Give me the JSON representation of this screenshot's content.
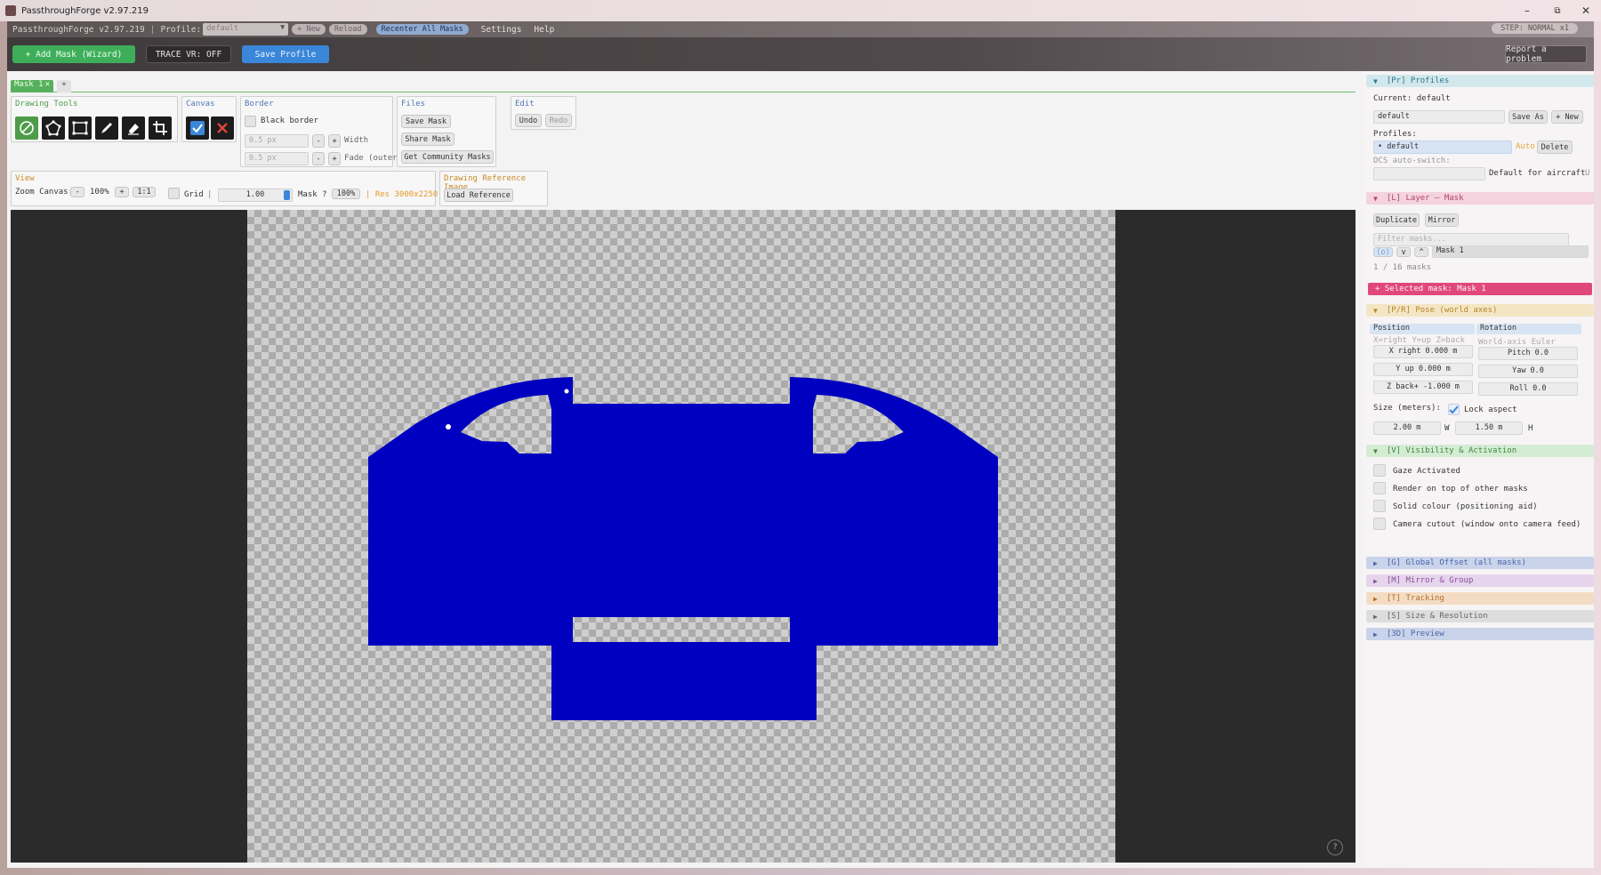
{
  "window": {
    "title": "PassthroughForge v2.97.219",
    "minimize": "–",
    "maximize": "⧉",
    "close": "✕"
  },
  "menubar": {
    "app_version": "PassthroughForge v2.97.219",
    "profile_label": "Profile:",
    "profile_value": "default",
    "new_label": "+ New",
    "reload_label": "Reload",
    "recenter_label": "Recenter All Masks",
    "settings_label": "Settings",
    "help_label": "Help",
    "step_label": "STEP: NORMAL  x1"
  },
  "toolbar": {
    "add_mask_label": "+  Add Mask  (Wizard)",
    "trace_label": "TRACE VR: OFF",
    "save_profile_label": "Save Profile",
    "report_label": "Report a problem"
  },
  "tabs": {
    "mask_tab": "Mask 1",
    "close_glyph": "✕",
    "add_glyph": "+"
  },
  "drawing_tools": {
    "title": "Drawing Tools",
    "tools": [
      "select-tool",
      "polygon-tool",
      "rectangle-tool",
      "pen-tool",
      "eraser-tool",
      "crop-tool"
    ]
  },
  "canvas_group": {
    "title": "Canvas"
  },
  "border": {
    "title": "Border",
    "black_border_label": "Black border",
    "width_value": "0.5 px",
    "width_label": "Width",
    "fade_value": "0.5 px",
    "fade_label": "Fade (outer)",
    "minus": "-",
    "plus": "+"
  },
  "files": {
    "title": "Files",
    "save_mask": "Save Mask",
    "share_mask": "Share Mask",
    "community": "Get Community Masks"
  },
  "edit": {
    "title": "Edit",
    "undo": "Undo",
    "redo": "Redo"
  },
  "view": {
    "title": "View",
    "zoom_label": "Zoom Canvas:",
    "zoom_minus": "-",
    "zoom_value": "100%",
    "zoom_plus": "+",
    "zoom_reset": "1:1",
    "grid_label": "Grid",
    "divider": "|",
    "opacity_value": "1.00",
    "mask_label": "Mask ?",
    "mask_pct": "100%",
    "res_label": "| Res 3000x2250"
  },
  "reference": {
    "title": "Drawing Reference Image",
    "load": "Load Reference"
  },
  "canvas": {
    "help": "?",
    "mask_color": "#0000c0"
  },
  "profiles": {
    "header": "[Pr] Profiles",
    "current_label": "Current: default",
    "name_value": "default",
    "save_as": "Save As",
    "new": "+ New",
    "profiles_label": "Profiles:",
    "list_item": "• default",
    "auto_label": "Auto",
    "delete_label": "Delete",
    "dcs_label": "DCS auto-switch:",
    "default_aircraft": "Default for aircraft",
    "u_label": "U"
  },
  "layer": {
    "header": "[L] Layer – Mask",
    "duplicate": "Duplicate",
    "mirror": "Mirror",
    "filter_placeholder": "Filter masks...",
    "eye_btn": "(o)",
    "down_btn": "v",
    "up_btn": "^",
    "mask_name": "Mask 1",
    "count": "1 / 16 masks"
  },
  "selected": {
    "label": "+  Selected mask:  Mask 1"
  },
  "pose": {
    "header": "[P/R] Pose (world axes)",
    "position_label": "Position",
    "rotation_label": "Rotation",
    "axes_hint": "X=right Y=up Z=back",
    "euler_hint": "World-axis Euler",
    "x_field": "X right  0.000 m",
    "y_field": "Y up   0.000 m",
    "z_field": "Z back+ -1.000 m",
    "pitch_field": "Pitch 0.0",
    "yaw_field": "Yaw  0.0",
    "roll_field": "Roll 0.0",
    "size_label": "Size (meters):",
    "lock_label": "Lock aspect",
    "width_value": "2.00 m",
    "w_label": "W",
    "height_value": "1.50 m",
    "h_label": "H"
  },
  "visibility": {
    "header": "[V] Visibility & Activation",
    "options": [
      "Gaze Activated",
      "Render on top of other masks",
      "Solid colour (positioning aid)",
      "Camera cutout (window onto camera feed)"
    ]
  },
  "collapsed_sections": [
    {
      "label": "[G] Global Offset (all masks)",
      "color": "#c9d3ea",
      "text": "#4a66a8"
    },
    {
      "label": "[M] Mirror & Group",
      "color": "#e6d4ec",
      "text": "#8a4e9a"
    },
    {
      "label": "[T] Tracking",
      "color": "#f4dcc4",
      "text": "#b66e2a"
    },
    {
      "label": "[S] Size & Resolution",
      "color": "#dddddd",
      "text": "#666666"
    },
    {
      "label": "[3D] Preview",
      "color": "#c9d3ea",
      "text": "#4a66a8"
    }
  ],
  "colors": {
    "accent_green": "#3fae5a",
    "accent_blue": "#3a86d8",
    "selected_pink": "#e0487c"
  }
}
